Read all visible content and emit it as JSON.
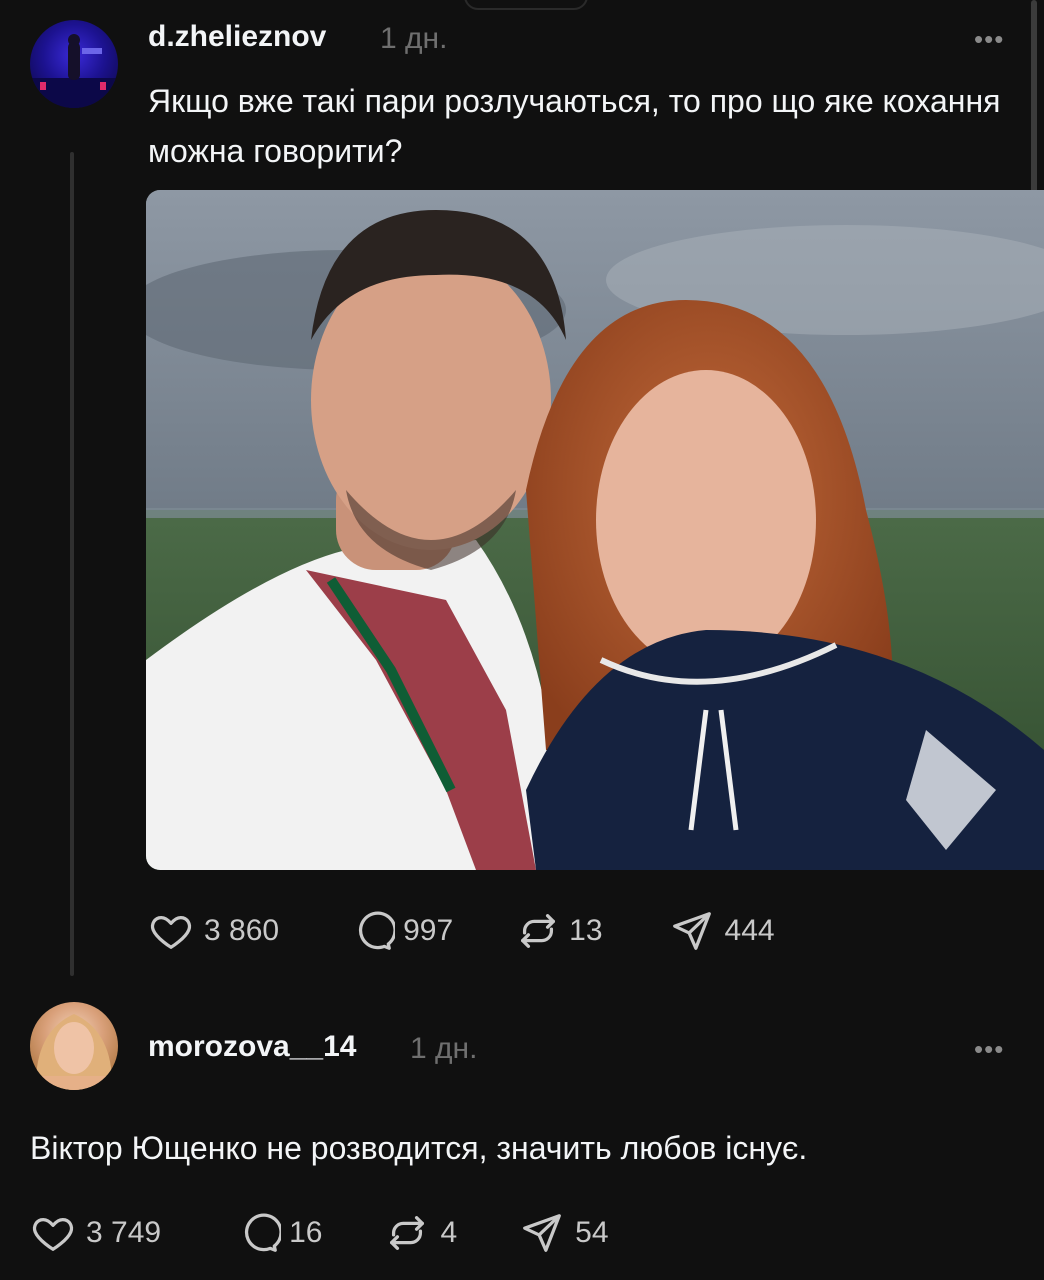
{
  "post": {
    "username": "d.zhelieznov",
    "timestamp": "1 дн.",
    "more_label": "•••",
    "text": "Якщо вже такі пари розлучаються, то про що яке кохання можна говорити?",
    "stats": {
      "likes": "3 860",
      "comments": "997",
      "reposts": "13",
      "shares": "444"
    }
  },
  "reply": {
    "username": "morozova__14",
    "timestamp": "1 дн.",
    "more_label": "•••",
    "text": "Віктор Ющенко не розводится, значить любов існує.",
    "stats": {
      "likes": "3 749",
      "comments": "16",
      "reposts": "4",
      "shares": "54"
    }
  },
  "icons": {
    "like": "heart-icon",
    "comment": "comment-icon",
    "repost": "repost-icon",
    "share": "send-icon",
    "more": "more-icon"
  },
  "colors": {
    "background": "#101010",
    "text": "#f3f5f7",
    "muted": "#6f6f6f",
    "thread_line": "#2f2f2f"
  }
}
